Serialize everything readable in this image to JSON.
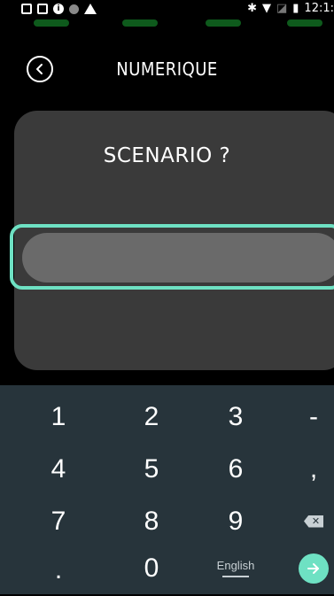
{
  "status_bar": {
    "time": "12:1:",
    "left_icons": [
      "screenshot-icon",
      "image-icon",
      "info-icon",
      "dot-icon",
      "warning-icon"
    ],
    "right_icons": [
      "bluetooth-icon",
      "wifi-icon",
      "no-signal-icon",
      "battery-icon"
    ]
  },
  "header": {
    "title": "NUMERIQUE",
    "back_icon": "back-arrow-icon"
  },
  "dialog": {
    "prompt": "SCENARIO ?",
    "input_value": "",
    "input_placeholder": ""
  },
  "keyboard": {
    "row1": [
      "1",
      "2",
      "3",
      "-"
    ],
    "row2": [
      "4",
      "5",
      "6",
      ","
    ],
    "row3": [
      "7",
      "8",
      "9"
    ],
    "row4_left": ".",
    "row4_zero": "0",
    "language": "English",
    "backspace_icon": "backspace-icon",
    "enter_icon": "arrow-right-icon"
  },
  "colors": {
    "accent": "#6ee1c3",
    "card": "#3a3a3a",
    "input": "#6a6a6a",
    "keyboard_bg": "#27343b",
    "led": "#0e5a1c"
  }
}
